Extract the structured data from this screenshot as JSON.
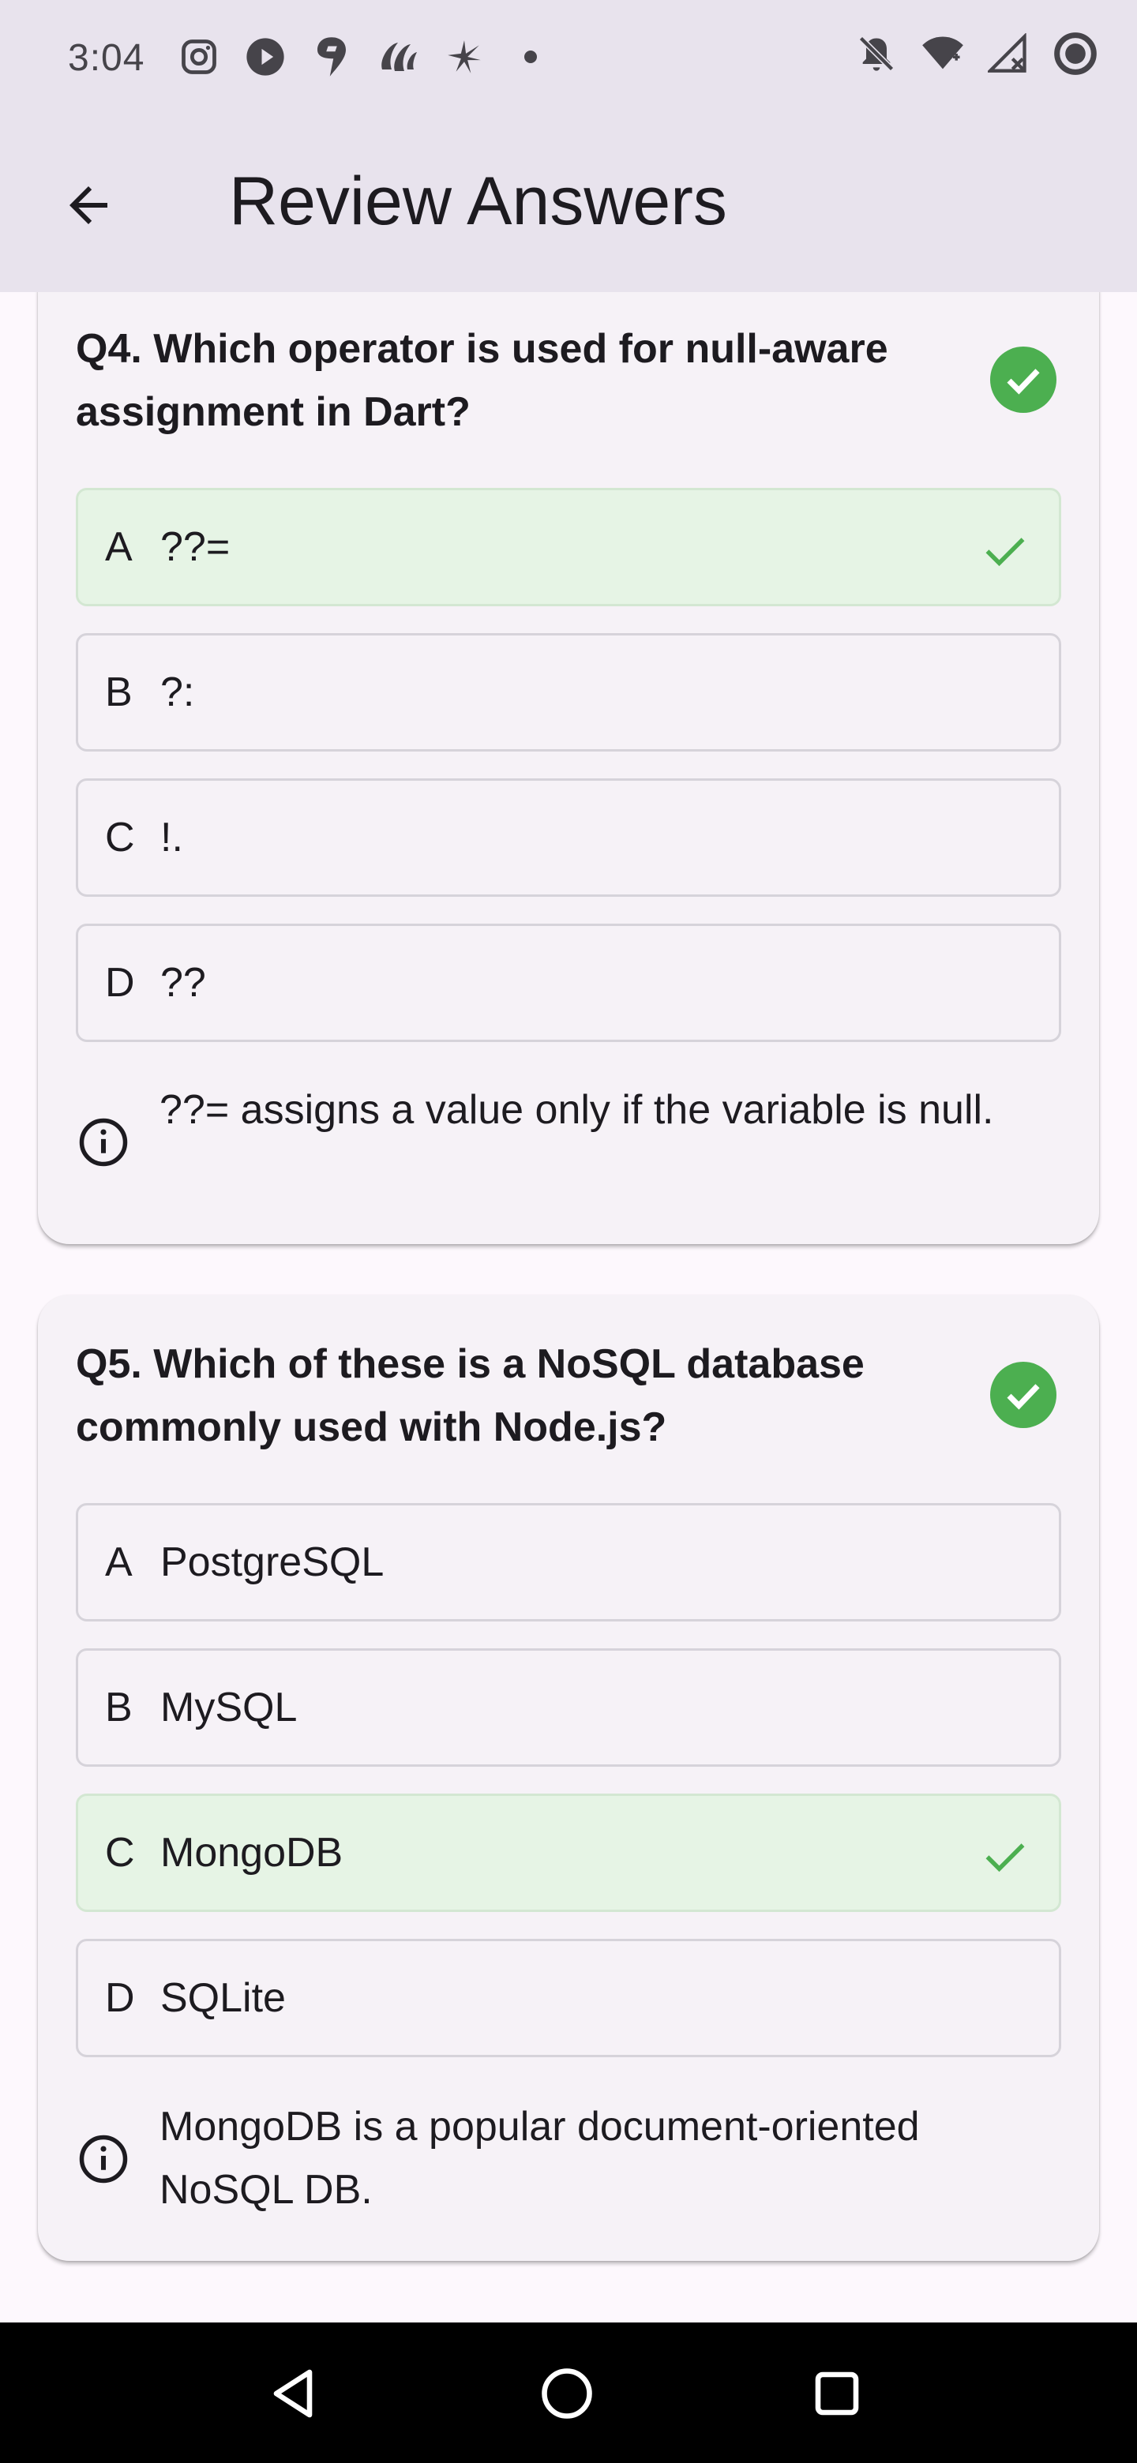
{
  "status_bar": {
    "time": "3:04",
    "left_icons": [
      "instagram-icon",
      "play-icon",
      "swiggy-icon",
      "app-icon",
      "sparkle-icon",
      "dot-icon"
    ],
    "right_icons": [
      "notifications-off-icon",
      "wifi-icon",
      "signal-icon",
      "battery-icon"
    ]
  },
  "app_bar": {
    "back_icon": "arrow-back-icon",
    "title": "Review Answers"
  },
  "questions": [
    {
      "title": "Q4. Which operator is used for null-aware assignment in Dart?",
      "correct": true,
      "options": [
        {
          "letter": "A",
          "text": "??=",
          "is_answer": true
        },
        {
          "letter": "B",
          "text": "?:",
          "is_answer": false
        },
        {
          "letter": "C",
          "text": "!.",
          "is_answer": false
        },
        {
          "letter": "D",
          "text": "??",
          "is_answer": false
        }
      ],
      "explanation": "??= assigns a value only if the variable is null."
    },
    {
      "title": "Q5. Which of these is a NoSQL database commonly used with Node.js?",
      "correct": true,
      "options": [
        {
          "letter": "A",
          "text": "PostgreSQL",
          "is_answer": false
        },
        {
          "letter": "B",
          "text": "MySQL",
          "is_answer": false
        },
        {
          "letter": "C",
          "text": "MongoDB",
          "is_answer": true
        },
        {
          "letter": "D",
          "text": "SQLite",
          "is_answer": false
        }
      ],
      "explanation": "MongoDB is a popular document-oriented NoSQL DB."
    }
  ],
  "colors": {
    "correct_green": "#4caf50",
    "correct_option_bg": "#e6f4e5",
    "app_bar_bg": "#e8e3ed",
    "card_bg": "#f6f2f7"
  },
  "nav_bar": {
    "back": "nav-back-icon",
    "home": "nav-home-icon",
    "recents": "nav-recents-icon"
  }
}
